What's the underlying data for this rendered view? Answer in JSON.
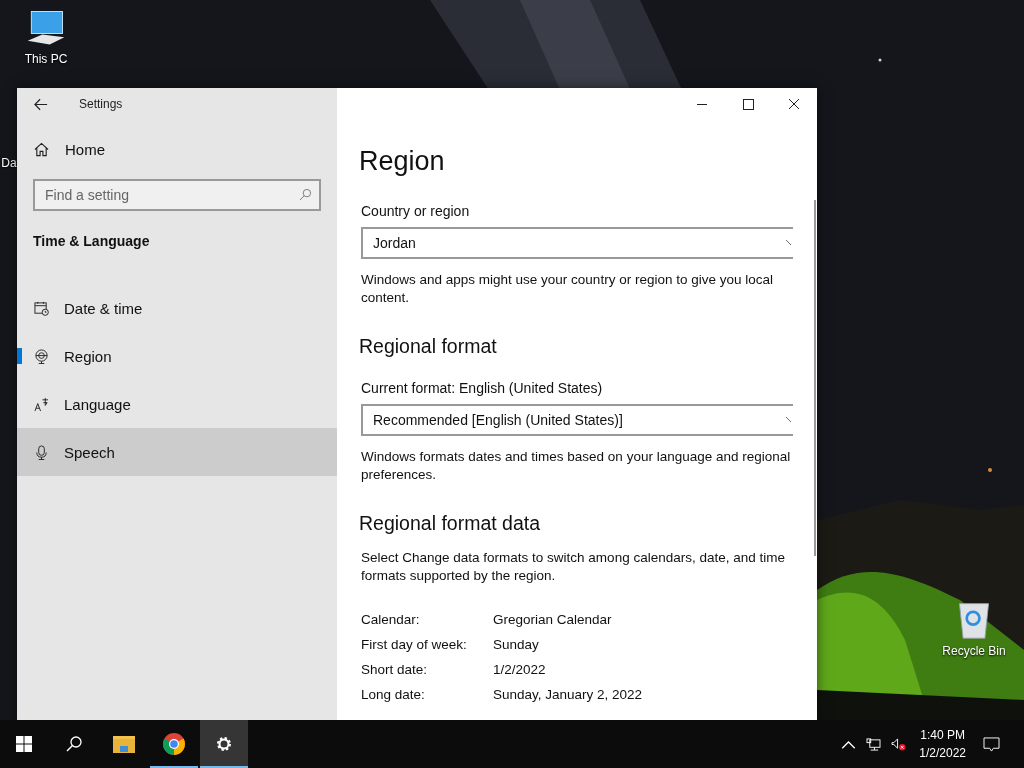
{
  "desktop": {
    "icons": [
      {
        "label": "This PC",
        "kind": "pc"
      },
      {
        "label": "Da",
        "kind": "file"
      },
      {
        "label": "Recycle Bin",
        "kind": "bin"
      }
    ]
  },
  "window": {
    "title": "Settings",
    "sidebar": {
      "home": "Home",
      "search": {
        "placeholder": "Find a setting"
      },
      "section": "Time & Language",
      "items": [
        {
          "label": "Date & time",
          "kind": "date",
          "selected": false,
          "hovered": false
        },
        {
          "label": "Region",
          "kind": "region",
          "selected": true,
          "hovered": false
        },
        {
          "label": "Language",
          "kind": "language",
          "selected": false,
          "hovered": false
        },
        {
          "label": "Speech",
          "kind": "speech",
          "selected": false,
          "hovered": true
        }
      ]
    },
    "content": {
      "title": "Region",
      "country": {
        "label": "Country or region",
        "value": "Jordan",
        "note": "Windows and apps might use your country or region to give you local content."
      },
      "regional_format": {
        "heading": "Regional format",
        "label": "Current format: English (United States)",
        "value": "Recommended [English (United States)]",
        "note": "Windows formats dates and times based on your language and regional preferences."
      },
      "format_data": {
        "heading": "Regional format data",
        "note": "Select Change data formats to switch among calendars, date, and time formats supported by the region.",
        "rows": [
          {
            "label": "Calendar:",
            "value": "Gregorian Calendar"
          },
          {
            "label": "First day of week:",
            "value": "Sunday"
          },
          {
            "label": "Short date:",
            "value": "1/2/2022"
          },
          {
            "label": "Long date:",
            "value": "Sunday, January 2, 2022"
          }
        ]
      }
    }
  },
  "taskbar": {
    "items": [
      {
        "kind": "start",
        "running": false,
        "active": false
      },
      {
        "kind": "search",
        "running": false,
        "active": false
      },
      {
        "kind": "explorer",
        "running": false,
        "active": false
      },
      {
        "kind": "chrome",
        "running": true,
        "active": false
      },
      {
        "kind": "settings",
        "running": true,
        "active": true
      }
    ],
    "tray": {
      "time": "1:40 PM",
      "date": "1/2/2022"
    }
  }
}
